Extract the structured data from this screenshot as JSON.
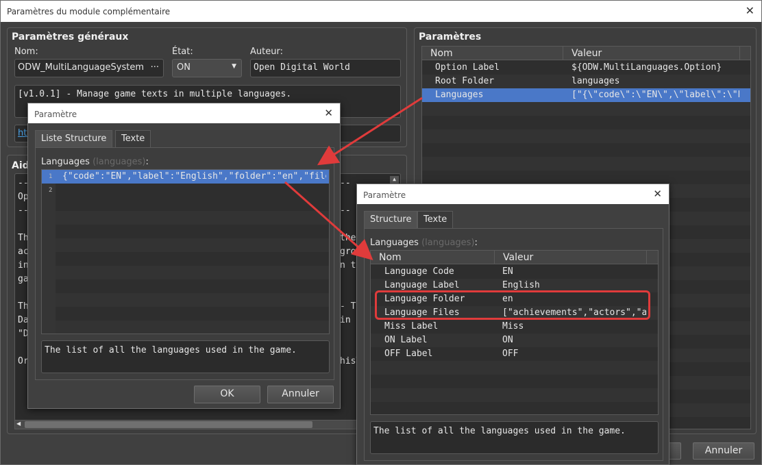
{
  "main": {
    "title": "Paramètres du module complémentaire",
    "general": {
      "title": "Paramètres généraux",
      "name_label": "Nom:",
      "name_value": "ODW_MultiLanguageSystem",
      "name_btn": "···",
      "state_label": "État:",
      "state_value": "ON",
      "author_label": "Auteur:",
      "author_value": "Open Digital World",
      "description": "[v1.0.1] - Manage game texts in multiple languages.",
      "link_stub": "htt"
    },
    "help": {
      "title": "Aid",
      "lines": [
        "--",
        "Ope",
        "--",
        "",
        "Thi",
        "act",
        "in",
        "gam",
        "",
        "Thi",
        "Dat",
        "\"D",
        "",
        "Or"
      ],
      "right_lines": [
        "--",
        "",
        "--",
        "",
        "the",
        "gro",
        "n t",
        "",
        "",
        "- Te",
        "in t",
        "",
        "",
        "hisT"
      ]
    },
    "params": {
      "title": "Paramètres",
      "col_name": "Nom",
      "col_value": "Valeur",
      "rows": [
        {
          "name": "Option Label",
          "value": "${ODW.MultiLanguages.Option}"
        },
        {
          "name": "Root Folder",
          "value": "languages"
        },
        {
          "name": "Languages",
          "value": "[\"{\\\"code\\\":\\\"EN\\\",\\\"label\\\":\\\"E···"
        }
      ]
    },
    "cancel_label": "Annuler"
  },
  "dialog1": {
    "title": "Paramètre",
    "tabs": [
      "Liste Structure",
      "Texte"
    ],
    "field_label": "Languages",
    "field_sub": "(languages)",
    "field_colon": ":",
    "list": [
      {
        "num": "1",
        "text": "{\"code\":\"EN\",\"label\":\"English\",\"folder\":\"en\",\"files\"···"
      },
      {
        "num": "2",
        "text": ""
      }
    ],
    "description": "The list of all the languages used in the game.",
    "ok_label": "OK",
    "cancel_label": "Annuler"
  },
  "dialog2": {
    "title": "Paramètre",
    "tabs": [
      "Structure",
      "Texte"
    ],
    "field_label": "Languages",
    "field_sub": "(languages)",
    "field_colon": ":",
    "col_name": "Nom",
    "col_value": "Valeur",
    "rows": [
      {
        "name": "Language Code",
        "value": "EN"
      },
      {
        "name": "Language Label",
        "value": "English"
      },
      {
        "name": "Language Folder",
        "value": "en"
      },
      {
        "name": "Language Files",
        "value": "[\"achievements\",\"actors\",\"a···"
      },
      {
        "name": "Miss Label",
        "value": "Miss"
      },
      {
        "name": "ON Label",
        "value": "ON"
      },
      {
        "name": "OFF Label",
        "value": "OFF"
      }
    ],
    "description": "The list of all the languages used in the game."
  },
  "colors": {
    "selection": "#4a78c8",
    "annotation": "#e03b3b"
  }
}
